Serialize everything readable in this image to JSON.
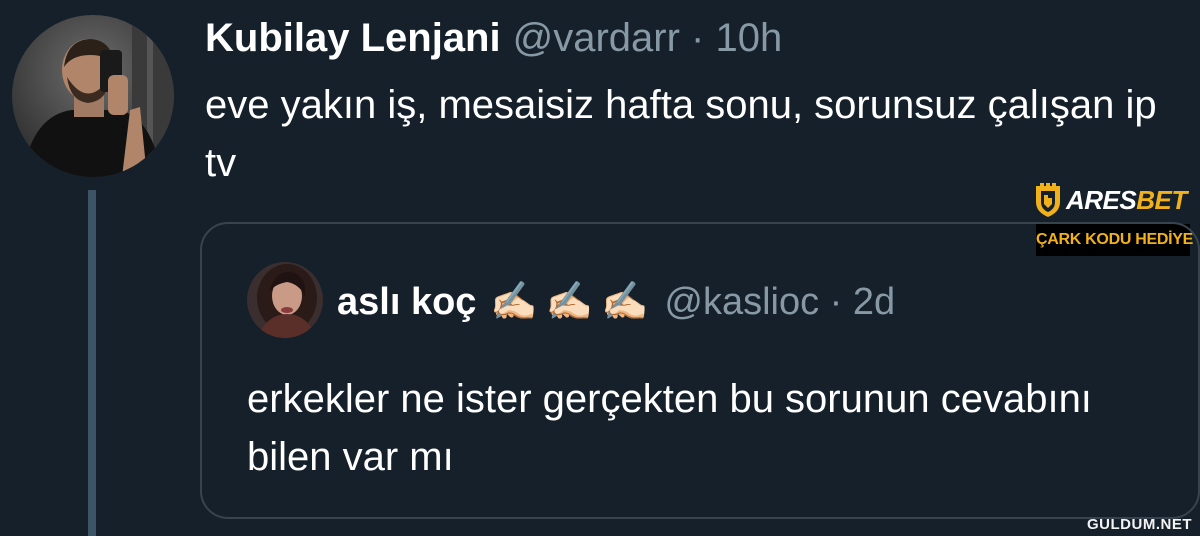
{
  "tweet": {
    "display_name": "Kubilay Lenjani",
    "handle_time": "@vardarr · 10h",
    "text": "eve yakın iş, mesaisiz hafta sonu, sorunsuz çalışan ip tv"
  },
  "quoted_tweet": {
    "display_name": "aslı koç",
    "emojis": "✍🏻✍🏻✍🏻",
    "handle_time": "@kaslioc · 2d",
    "text": "erkekler ne ister gerçekten bu sorunun cevabını bilen var mı"
  },
  "ad": {
    "brand_ares": "ARES",
    "brand_bet": "BET",
    "promo": "ÇARK KODU HEDİYE",
    "icon": "castle-shield-icon"
  },
  "watermark": "GULDUM.NET",
  "colors": {
    "background": "#15202b",
    "secondary_text": "#8899a6",
    "border": "#38444d",
    "thread_line": "#3d5466",
    "ad_gold": "#f0b11a"
  }
}
